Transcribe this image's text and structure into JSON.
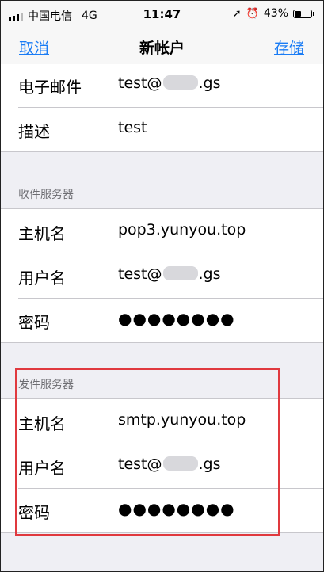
{
  "status_bar": {
    "carrier": "中国电信",
    "network": "4G",
    "time": "11:47",
    "battery": "43%",
    "battery_level": 0.43
  },
  "nav": {
    "cancel_label": "取消",
    "title": "新帐户",
    "save_label": "存储"
  },
  "account": {
    "email_label": "电子邮件",
    "email_prefix": "test@",
    "email_suffix": ".gs",
    "description_label": "描述",
    "description_value": "test"
  },
  "incoming": {
    "header": "收件服务器",
    "host_label": "主机名",
    "host_value": "pop3.yunyou.top",
    "user_label": "用户名",
    "user_prefix": "test@",
    "user_suffix": ".gs",
    "password_label": "密码",
    "password_value": "●●●●●●●●"
  },
  "outgoing": {
    "header": "发件服务器",
    "host_label": "主机名",
    "host_value": "smtp.yunyou.top",
    "user_label": "用户名",
    "user_prefix": "test@",
    "user_suffix": ".gs",
    "password_label": "密码",
    "password_value": "●●●●●●●●"
  },
  "colors": {
    "accent": "#1a7cf5",
    "highlight": "#e0393e"
  }
}
